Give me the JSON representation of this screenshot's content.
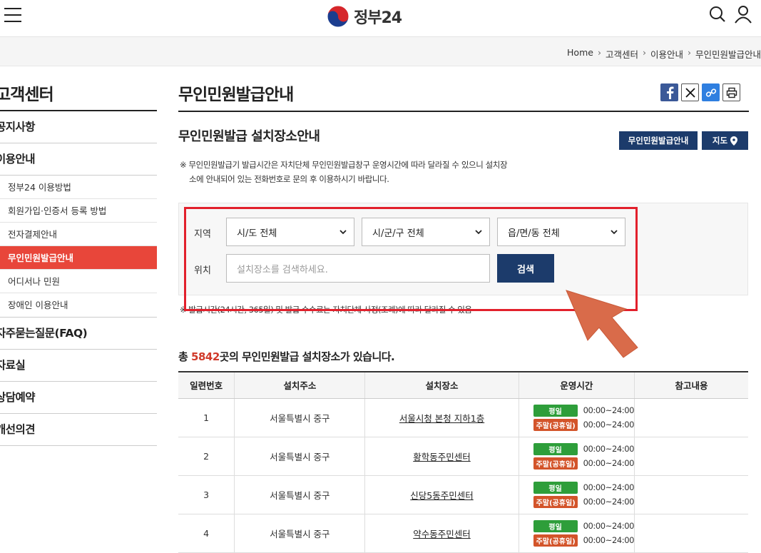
{
  "header": {
    "logo_text": "정부24"
  },
  "breadcrumb": [
    "Home",
    "고객센터",
    "이용안내",
    "무인민원발급안내"
  ],
  "sidebar": {
    "title": "고객센터",
    "items": [
      {
        "label": "공지사항"
      },
      {
        "label": "이용안내"
      }
    ],
    "sub_items": [
      {
        "label": "정부24 이용방법"
      },
      {
        "label": "회원가입·인증서 등록 방법"
      },
      {
        "label": "전자결제안내"
      },
      {
        "label": "무인민원발급안내"
      },
      {
        "label": "어디서나 민원"
      },
      {
        "label": "장애인 이용안내"
      }
    ],
    "bottom_items": [
      {
        "label": "자주묻는질문(FAQ)"
      },
      {
        "label": "자료실"
      },
      {
        "label": "상담예약"
      },
      {
        "label": "개선의견"
      }
    ]
  },
  "main": {
    "title": "무인민원발급안내",
    "sub_title": "무인민원발급 설치장소안내",
    "btn_info": "무인민원발급안내",
    "btn_map": "지도",
    "notice_line1": "※ 무인민원발급기 발급시간은 자치단체 무인민원발급창구 운영시간에 따라 달라질 수 있으니 설치장",
    "notice_line2": "소에 안내되어 있는 전화번호로 문의 후 이용하시기 바랍니다.",
    "search": {
      "region_label": "지역",
      "location_label": "위치",
      "sido": "시/도 전체",
      "sigungu": "시/군/구 전체",
      "eupmyeondong": "읍/면/동 전체",
      "placeholder": "설치장소를 검색하세요.",
      "button": "검색"
    },
    "notice2": "※ 발급시간(24시간, 365일) 및 발급 수수료는 자치단체 사정(조례)에 따라 달라질 수 있음",
    "count_prefix": "총 ",
    "count": "5842",
    "count_suffix": "곳의 무인민원발급 설치장소가 있습니다."
  },
  "table": {
    "headers": [
      "일련번호",
      "설치주소",
      "설치장소",
      "운영시간",
      "참고내용"
    ],
    "weekday_tag": "평일",
    "weekend_tag": "주말(공휴일)",
    "rows": [
      {
        "no": "1",
        "address": "서울특별시 중구",
        "place": "서울시청 본청 지하1층",
        "weekday": "00:00~24:00",
        "weekend": "00:00~24:00"
      },
      {
        "no": "2",
        "address": "서울특별시 중구",
        "place": "황학동주민센터",
        "weekday": "00:00~24:00",
        "weekend": "00:00~24:00"
      },
      {
        "no": "3",
        "address": "서울특별시 중구",
        "place": "신당5동주민센터",
        "weekday": "00:00~24:00",
        "weekend": "00:00~24:00"
      },
      {
        "no": "4",
        "address": "서울특별시 중구",
        "place": "약수동주민센터",
        "weekday": "00:00~24:00",
        "weekend": "00:00~24:00"
      }
    ]
  },
  "colors": {
    "navy": "#1c3b6b",
    "accent_red": "#e8463a",
    "highlight_frame": "#e2202c",
    "arrow": "#d96b4a",
    "weekday_green": "#2e9e3a",
    "weekend_orange": "#d3542a"
  }
}
